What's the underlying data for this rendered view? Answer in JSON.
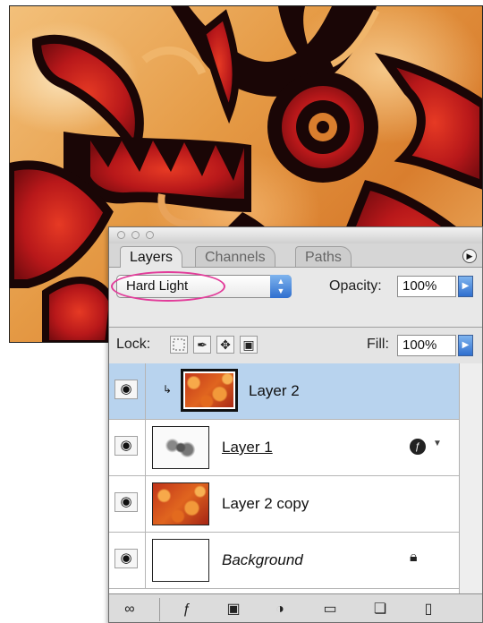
{
  "palette": {
    "tabs": [
      {
        "label": "Layers",
        "active": true
      },
      {
        "label": "Channels",
        "active": false
      },
      {
        "label": "Paths",
        "active": false
      }
    ],
    "menu_icon": "triangle-right-icon",
    "blend_mode": {
      "value": "Hard Light",
      "highlight_color": "#e23c9a"
    },
    "opacity": {
      "label": "Opacity:",
      "value": "100%"
    },
    "lock": {
      "label": "Lock:",
      "icons": [
        "transparency-lock-icon",
        "brush-lock-icon",
        "move-lock-icon",
        "padlock-icon"
      ]
    },
    "fill": {
      "label": "Fill:",
      "value": "100%"
    },
    "layers": [
      {
        "name": "Layer 2",
        "thumbnail": "fire-texture",
        "visible": true,
        "selected": true,
        "clipped": true
      },
      {
        "name": "Layer 1",
        "thumbnail": "sketch",
        "visible": true,
        "selected": false,
        "has_effects": true
      },
      {
        "name": "Layer 2 copy",
        "thumbnail": "fire-texture",
        "visible": true,
        "selected": false
      },
      {
        "name": "Background",
        "thumbnail": "white",
        "visible": true,
        "selected": false,
        "locked": true
      }
    ],
    "bottom_icons": [
      "link-icon",
      "layer-style-icon",
      "mask-icon",
      "adjustment-layer-icon",
      "folder-icon",
      "new-layer-icon",
      "trash-icon"
    ],
    "colors": {
      "selected_row": "#b8d3ee",
      "accent_blue": "#2f6fcf"
    }
  }
}
